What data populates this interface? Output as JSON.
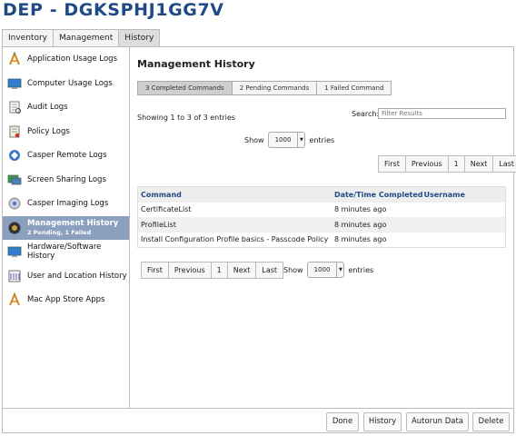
{
  "title": "DEP - DGKSPHJ1GG7V",
  "tabs": [
    {
      "label": "Inventory"
    },
    {
      "label": "Management"
    },
    {
      "label": "History"
    }
  ],
  "sidebar": {
    "items": [
      {
        "label": "Application Usage Logs",
        "sub": "",
        "icon": "application-icon"
      },
      {
        "label": "Computer Usage Logs",
        "sub": "",
        "icon": "computer-icon"
      },
      {
        "label": "Audit Logs",
        "sub": "",
        "icon": "audit-icon"
      },
      {
        "label": "Policy Logs",
        "sub": "",
        "icon": "policy-icon"
      },
      {
        "label": "Casper Remote Logs",
        "sub": "",
        "icon": "remote-icon"
      },
      {
        "label": "Screen Sharing Logs",
        "sub": "",
        "icon": "screen-sharing-icon"
      },
      {
        "label": "Casper Imaging Logs",
        "sub": "",
        "icon": "imaging-icon"
      },
      {
        "label": "Management History",
        "sub": "2 Pending, 1 Failed",
        "icon": "management-icon"
      },
      {
        "label": "Hardware/Software History",
        "sub": "",
        "icon": "hardware-icon"
      },
      {
        "label": "User and Location History",
        "sub": "",
        "icon": "user-location-icon"
      },
      {
        "label": "Mac App Store Apps",
        "sub": "",
        "icon": "app-store-icon"
      }
    ]
  },
  "main": {
    "heading": "Management History",
    "segments": [
      {
        "label": "3 Completed Commands"
      },
      {
        "label": "2 Pending Commands"
      },
      {
        "label": "1 Failed Command"
      }
    ],
    "showing": "Showing 1 to 3 of 3 entries",
    "search_label": "Search:",
    "search_placeholder": "Filter Results",
    "show_label": "Show",
    "entries_label": "entries",
    "page_size": "1000",
    "pager": {
      "first": "First",
      "previous": "Previous",
      "page": "1",
      "next": "Next",
      "last": "Last"
    },
    "columns": [
      "Command",
      "Date/Time Completed",
      "Username"
    ],
    "rows": [
      {
        "command": "CertificateList",
        "time": "8 minutes ago",
        "user": ""
      },
      {
        "command": "ProfileList",
        "time": "8 minutes ago",
        "user": ""
      },
      {
        "command": "Install Configuration Profile basics - Passcode Policy",
        "time": "8 minutes ago",
        "user": ""
      }
    ]
  },
  "footer": {
    "done": "Done",
    "history": "History",
    "autorun": "Autorun Data",
    "delete": "Delete"
  },
  "colors": {
    "title": "#1f4a86",
    "active_sidebar": "#8aa0be"
  }
}
